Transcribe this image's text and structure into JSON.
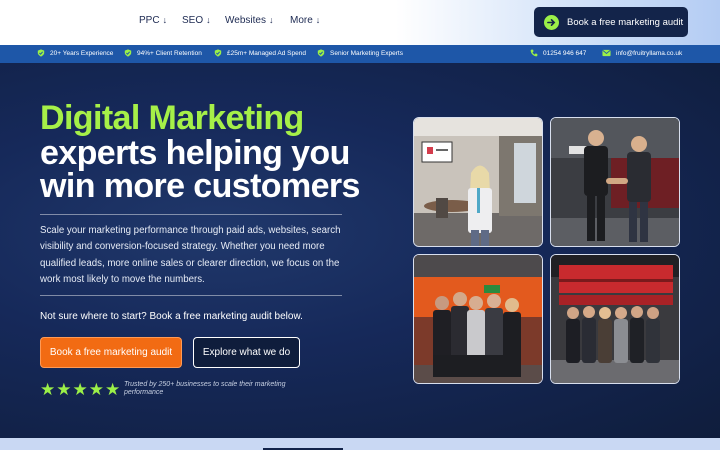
{
  "nav": {
    "items": [
      {
        "label": "PPC",
        "arrow": "↓"
      },
      {
        "label": "SEO",
        "arrow": "↓"
      },
      {
        "label": "Websites",
        "arrow": "↓"
      },
      {
        "label": "More",
        "arrow": "↓"
      }
    ],
    "cta_label": "Book a free marketing audit"
  },
  "strip": {
    "badges": [
      "20+ Years Experience",
      "94%+ Client Retention",
      "£25m+ Managed Ad Spend",
      "Senior Marketing Experts"
    ],
    "phone": "01254 946 647",
    "email": "info@fruitryllama.co.uk"
  },
  "hero": {
    "title_line1": "Digital Marketing",
    "title_line2": "experts helping you",
    "title_line3": "win more customers",
    "description": "Scale your marketing performance through paid ads, websites, search visibility and conversion-focused strategy. Whether you need more qualified leads, more online sales or clearer direction, we focus on the work most likely to move the numbers.",
    "subtext": "Not sure where to start? Book a free marketing audit below.",
    "primary_button": "Book a free marketing audit",
    "secondary_button": "Explore what we do",
    "stars": [
      "★",
      "★",
      "★",
      "★",
      "★"
    ],
    "trust_text": "Trusted by 250+ businesses to scale their marketing performance"
  },
  "colors": {
    "accent_green": "#9bf048",
    "accent_orange": "#f26b13",
    "navy": "#13244a",
    "strip_blue": "#1e57a8"
  }
}
